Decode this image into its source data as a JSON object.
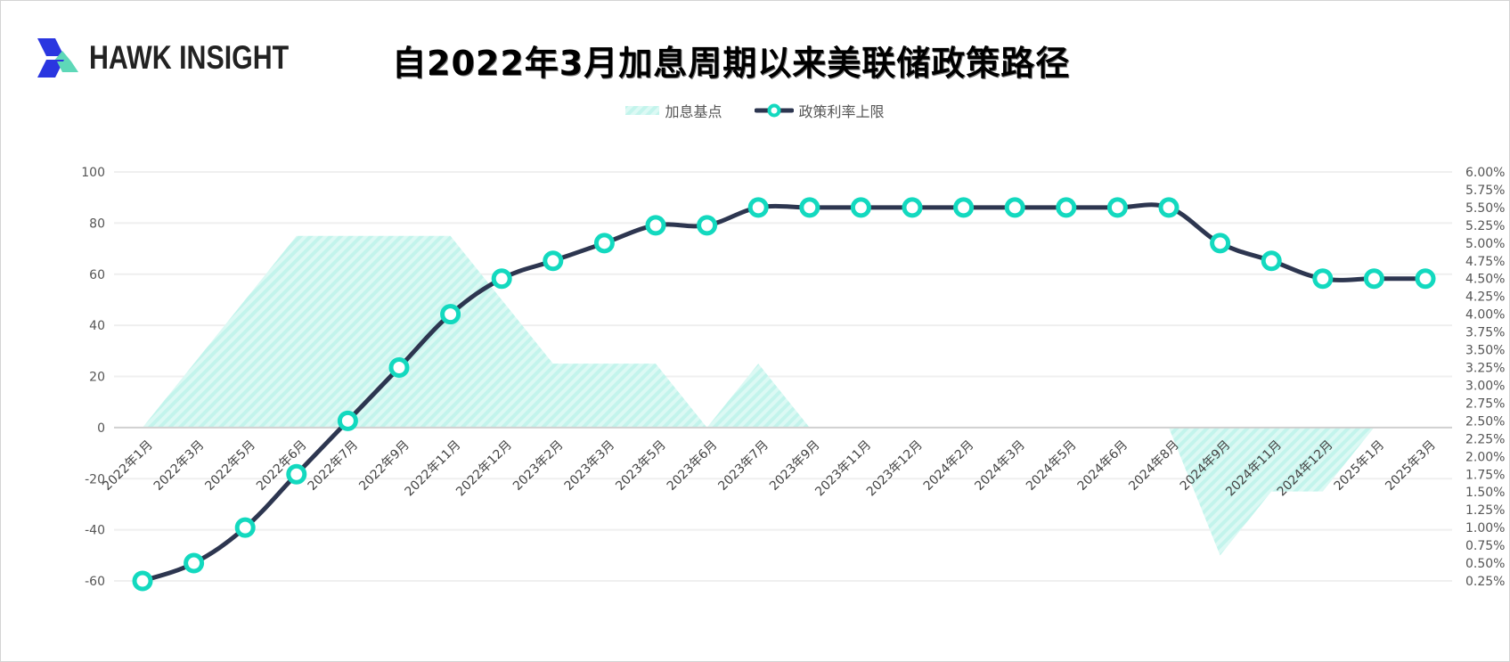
{
  "brand": {
    "name": "HAWK INSIGHT",
    "colors": {
      "blue": "#2a36e0",
      "teal": "#5ed8b8"
    }
  },
  "chart_data": {
    "type": "line+area",
    "title": "自2022年3月加息周期以来美联储政策路径",
    "xlabel": "",
    "ylabel_left": "",
    "ylabel_right": "",
    "legend_position": "top-center",
    "grid": true,
    "categories": [
      "2022年1月",
      "2022年3月",
      "2022年5月",
      "2022年6月",
      "2022年7月",
      "2022年9月",
      "2022年11月",
      "2022年12月",
      "2023年2月",
      "2023年3月",
      "2023年5月",
      "2023年6月",
      "2023年7月",
      "2023年9月",
      "2023年11月",
      "2023年12月",
      "2024年2月",
      "2024年3月",
      "2024年5月",
      "2024年6月",
      "2024年8月",
      "2024年9月",
      "2024年11月",
      "2024年12月",
      "2025年1月",
      "2025年3月"
    ],
    "series": [
      {
        "name": "加息基点",
        "type": "area",
        "axis": "left",
        "color": "#c8f5ee",
        "values": [
          0,
          25,
          50,
          75,
          75,
          75,
          75,
          50,
          25,
          25,
          25,
          0,
          25,
          0,
          0,
          0,
          0,
          0,
          0,
          0,
          0,
          -50,
          -25,
          -25,
          0,
          0
        ]
      },
      {
        "name": "政策利率上限",
        "type": "line",
        "axis": "right",
        "unit": "%",
        "color": "#2d3650",
        "marker_color": "#13d9bf",
        "values": [
          0.25,
          0.5,
          1.0,
          1.75,
          2.5,
          3.25,
          4.0,
          4.5,
          4.75,
          5.0,
          5.25,
          5.25,
          5.5,
          5.5,
          5.5,
          5.5,
          5.5,
          5.5,
          5.5,
          5.5,
          5.5,
          5.0,
          4.75,
          4.5,
          4.5,
          4.5
        ]
      }
    ],
    "y_left": {
      "ylim": [
        -60,
        100
      ],
      "ticks": [
        100,
        80,
        60,
        40,
        20,
        0,
        -20,
        -40,
        -60
      ]
    },
    "y_right": {
      "ylim": [
        0.25,
        6.0
      ],
      "ticks": [
        "6.00%",
        "5.75%",
        "5.50%",
        "5.25%",
        "5.00%",
        "4.75%",
        "4.50%",
        "4.25%",
        "4.00%",
        "3.75%",
        "3.50%",
        "3.25%",
        "3.00%",
        "2.75%",
        "2.50%",
        "2.25%",
        "2.00%",
        "1.75%",
        "1.50%",
        "1.25%",
        "1.00%",
        "0.75%",
        "0.50%",
        "0.25%"
      ]
    }
  }
}
